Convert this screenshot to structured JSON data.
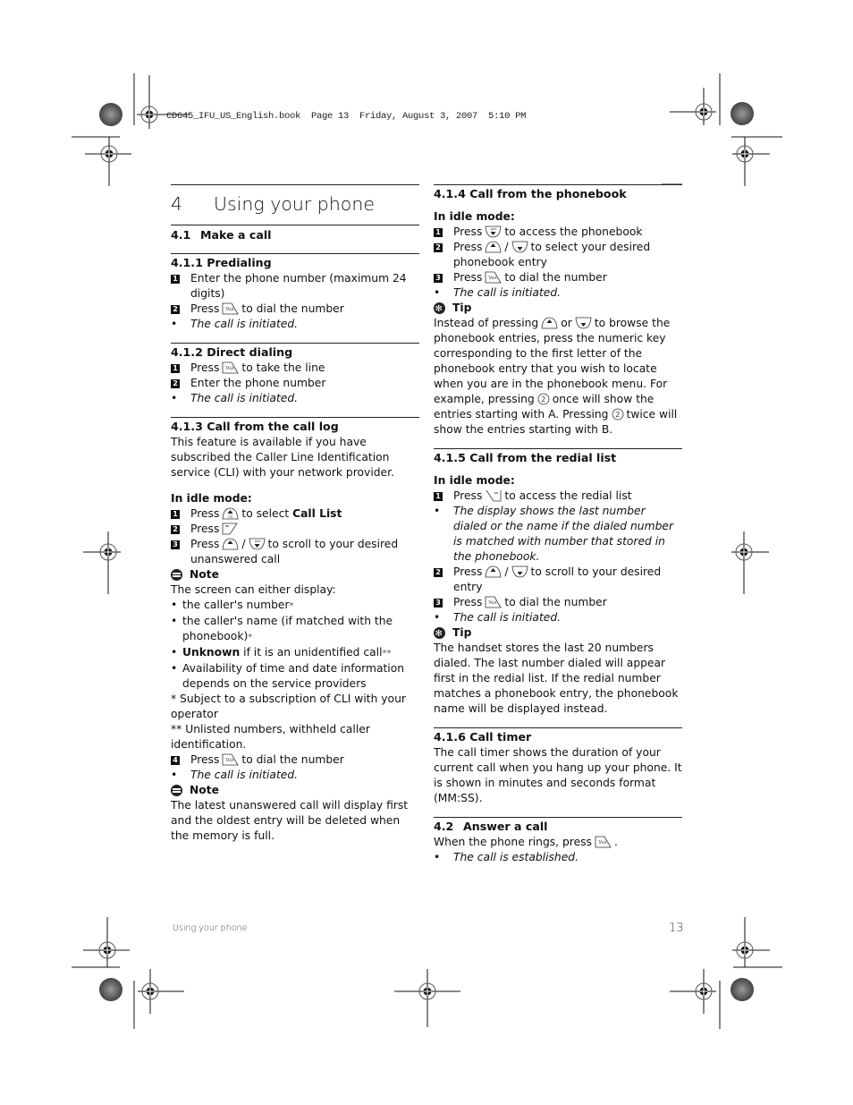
{
  "print_header": "CD645_IFU_US_English.book  Page 13  Friday, August 3, 2007  5:10 PM",
  "chapter": {
    "number": "4",
    "title": "Using your phone"
  },
  "section_4_1": {
    "number": "4.1",
    "title": "Make a call"
  },
  "s411": {
    "title": "4.1.1  Predialing",
    "steps": [
      "Enter the phone number (maximum 24 digits)",
      "Press",
      "to dial the number"
    ],
    "result": "The call is initiated."
  },
  "s412": {
    "title": "4.1.2  Direct dialing",
    "step1_a": "Press",
    "step1_b": "to take the line",
    "step2": "Enter the phone number",
    "result": "The call is initiated."
  },
  "s413": {
    "title": "4.1.3  Call from the call log",
    "intro": "This feature is available if you have subscribed the Caller Line Identification service (CLI) with your network provider.",
    "idle": "In idle mode:",
    "step1_a": "Press",
    "step1_b": "to select",
    "step1_c": "Call List",
    "step2": "Press",
    "step3_a": "Press",
    "step3_b": "to scroll to your desired unanswered call",
    "note_label": "Note",
    "note_intro": "The screen can either display:",
    "bullets": [
      "the caller's number",
      "the caller's name (if matched with the phonebook)",
      "if it is an unidentified call",
      "Availability of time and date information depends on the service providers"
    ],
    "bullet_unknown": "Unknown",
    "star1": "*",
    "star2": "**",
    "footnote1": "*  Subject to a subscription of CLI with your operator",
    "footnote2": "** Unlisted numbers, withheld caller identification.",
    "step4_a": "Press",
    "step4_b": "to dial the number",
    "result": "The call is initiated.",
    "note2_label": "Note",
    "note2_text": "The latest unanswered call will display first and the oldest entry will be deleted when the memory is full."
  },
  "s414": {
    "title": "4.1.4  Call from the phonebook",
    "idle": "In idle mode:",
    "step1_a": "Press",
    "step1_b": "to access the phonebook",
    "step2_a": "Press",
    "step2_b": "to select your desired phonebook entry",
    "step3_a": "Press",
    "step3_b": "to dial the number",
    "result": "The call is initiated.",
    "tip_label": "Tip",
    "tip_a": "Instead of pressing",
    "tip_or": "or",
    "tip_b": "to browse the phonebook entries, press the numeric key corresponding to the first letter of the phonebook entry that you wish to locate when you are in the phonebook menu.  For example, pressing",
    "tip_c": "once will show the entries starting with A. Pressing",
    "tip_d": "twice will show the entries starting with B."
  },
  "s415": {
    "title": "4.1.5  Call from the redial list",
    "idle": "In idle mode:",
    "step1_a": "Press",
    "step1_b": "to access the redial list",
    "info": "The display shows the last number dialed or the name if the dialed number is matched with number that stored in the phonebook.",
    "step2_a": "Press",
    "step2_b": "to scroll to your desired entry",
    "step3_a": "Press",
    "step3_b": "to dial the number",
    "result": "The call is initiated.",
    "tip_label": "Tip",
    "tip_text": "The handset stores the last 20 numbers dialed. The last number dialed will appear first in the redial list. If the redial number matches a phonebook entry, the phonebook name will be displayed instead."
  },
  "s416": {
    "title": "4.1.6  Call timer",
    "text": "The call timer shows the duration of your current call when you hang up your phone. It is shown in minutes and seconds format (MM:SS)."
  },
  "s42": {
    "number": "4.2",
    "title": "Answer a call",
    "text_a": "When the phone rings, press",
    "text_b": ".",
    "result": "The call is established."
  },
  "footer": {
    "section": "Using your phone",
    "page": "13"
  },
  "icons": {
    "talk": "talk-key-icon",
    "up_cid": "up-cid-key-icon",
    "down_pbk": "down-phonebook-key-icon",
    "menu": "left-softkey-icon",
    "redial": "right-softkey-icon",
    "two": "key-2-icon"
  }
}
